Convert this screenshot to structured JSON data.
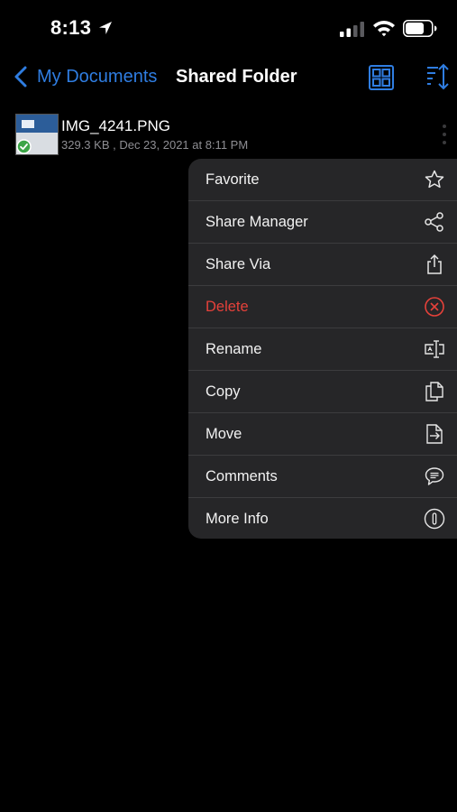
{
  "status_bar": {
    "time": "8:13",
    "icons": [
      "location-arrow-icon",
      "cellular-signal-icon",
      "wifi-icon",
      "battery-icon"
    ]
  },
  "nav": {
    "back_label": "My Documents",
    "title": "Shared Folder",
    "accent_color": "#2f7de1",
    "icons": [
      "back-chevron-icon",
      "grid-view-icon",
      "sort-icon"
    ]
  },
  "file": {
    "name": "IMG_4241.PNG",
    "meta": "329.3 KB , Dec 23, 2021 at 8:11 PM",
    "status": "synced-check-icon"
  },
  "menu": {
    "items": [
      {
        "label": "Favorite",
        "icon": "star-icon"
      },
      {
        "label": "Share Manager",
        "icon": "share-nodes-icon"
      },
      {
        "label": "Share Via",
        "icon": "share-upload-icon"
      },
      {
        "label": "Delete",
        "icon": "delete-circle-x-icon",
        "color": "#e5413a"
      },
      {
        "label": "Rename",
        "icon": "rename-cursor-icon"
      },
      {
        "label": "Copy",
        "icon": "copy-icon"
      },
      {
        "label": "Move",
        "icon": "move-icon"
      },
      {
        "label": "Comments",
        "icon": "comment-bubble-icon"
      },
      {
        "label": "More Info",
        "icon": "info-icon"
      }
    ]
  }
}
